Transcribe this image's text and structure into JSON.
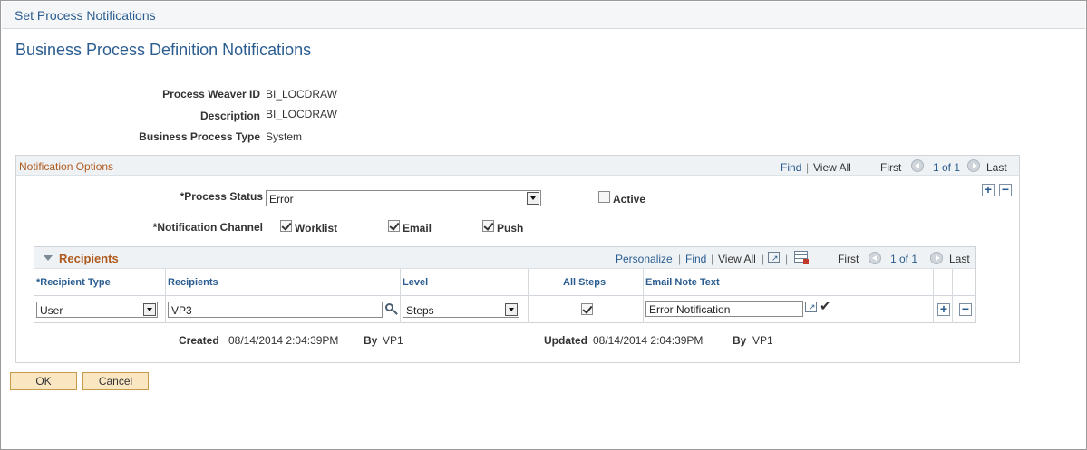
{
  "window": {
    "title": "Set Process Notifications"
  },
  "page": {
    "title": "Business Process Definition Notifications"
  },
  "fields": {
    "process_weaver_id": {
      "label": "Process Weaver ID",
      "value": "BI_LOCDRAW"
    },
    "description": {
      "label": "Description",
      "value": "BI_LOCDRAW"
    },
    "business_process_type": {
      "label": "Business Process Type",
      "value": "System"
    }
  },
  "notification_options": {
    "title": "Notification Options",
    "nav": {
      "find": "Find",
      "view_all": "View All",
      "first": "First",
      "range": "1 of 1",
      "last": "Last"
    },
    "process_status": {
      "label": "*Process Status",
      "value": "Error"
    },
    "active": {
      "label": "Active",
      "checked": false
    },
    "channel": {
      "label": "*Notification Channel",
      "worklist": {
        "label": "Worklist",
        "checked": true
      },
      "email": {
        "label": "Email",
        "checked": true
      },
      "push": {
        "label": "Push",
        "checked": true
      }
    }
  },
  "recipients": {
    "title": "Recipients",
    "nav": {
      "personalize": "Personalize",
      "find": "Find",
      "view_all": "View All",
      "first": "First",
      "range": "1 of 1",
      "last": "Last"
    },
    "columns": {
      "recipient_type": "*Recipient Type",
      "recipients": "Recipients",
      "level": "Level",
      "all_steps": "All Steps",
      "email_note_text": "Email Note Text"
    },
    "rows": [
      {
        "recipient_type": "User",
        "recipients": "VP3",
        "level": "Steps",
        "all_steps": true,
        "email_note_text": "Error Notification"
      }
    ]
  },
  "audit": {
    "created_label": "Created",
    "created_value": "08/14/2014  2:04:39PM",
    "created_by_label": "By",
    "created_by": "VP1",
    "updated_label": "Updated",
    "updated_value": "08/14/2014  2:04:39PM",
    "updated_by_label": "By",
    "updated_by": "VP1"
  },
  "buttons": {
    "ok": "OK",
    "cancel": "Cancel"
  },
  "colors": {
    "accent": "#2b5d90",
    "section_title": "#b05a1e",
    "button_bg": "#fbe6c2"
  },
  "icons": [
    "collapse-triangle-icon",
    "zoom-icon",
    "download-grid-icon",
    "lookup-icon",
    "expand-text-icon",
    "spellcheck-icon",
    "add-row-icon",
    "delete-row-icon",
    "previous-arrow-icon",
    "next-arrow-icon"
  ]
}
